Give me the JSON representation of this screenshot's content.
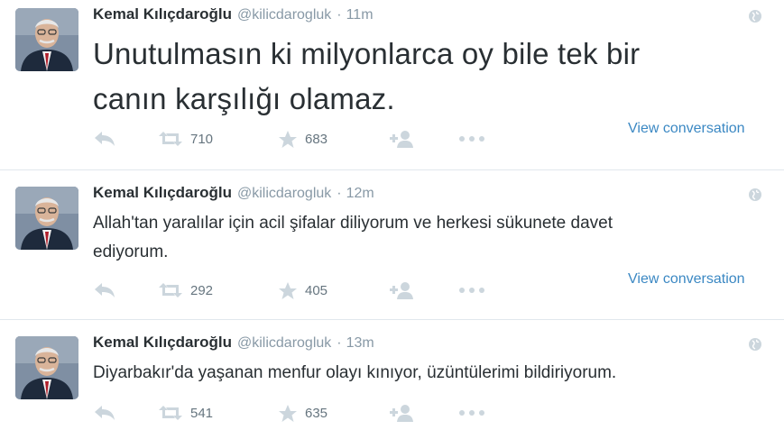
{
  "colors": {
    "name": "#292f33",
    "muted": "#8899a6",
    "link": "#3b88c3",
    "icon": "#ccd6dd",
    "divider": "#e1e8ed"
  },
  "tweets": [
    {
      "name": "Kemal Kılıçdaroğlu",
      "handle": "@kilicdarogluk",
      "dot": "·",
      "time": "11m",
      "lines": [
        "Unutulmasın ki milyonlarca oy bile tek bir",
        "canın karşılığı olamaz."
      ],
      "retweets": "710",
      "favorites": "683",
      "view_conversation": "View conversation"
    },
    {
      "name": "Kemal Kılıçdaroğlu",
      "handle": "@kilicdarogluk",
      "dot": "·",
      "time": "12m",
      "lines": [
        "Allah'tan yaralılar için acil şifalar diliyorum ve herkesi sükunete davet",
        "ediyorum."
      ],
      "retweets": "292",
      "favorites": "405",
      "view_conversation": "View conversation"
    },
    {
      "name": "Kemal Kılıçdaroğlu",
      "handle": "@kilicdarogluk",
      "dot": "·",
      "time": "13m",
      "lines": [
        "Diyarbakır'da yaşanan menfur olayı kınıyor, üzüntülerimi bildiriyorum."
      ],
      "retweets": "541",
      "favorites": "635"
    }
  ],
  "icons": {
    "avatar": "avatar-portrait",
    "globe": "globe-icon",
    "reply": "reply-icon",
    "retweet": "retweet-icon",
    "favorite": "star-icon",
    "follow": "follow-icon",
    "more": "more-dots-icon"
  }
}
